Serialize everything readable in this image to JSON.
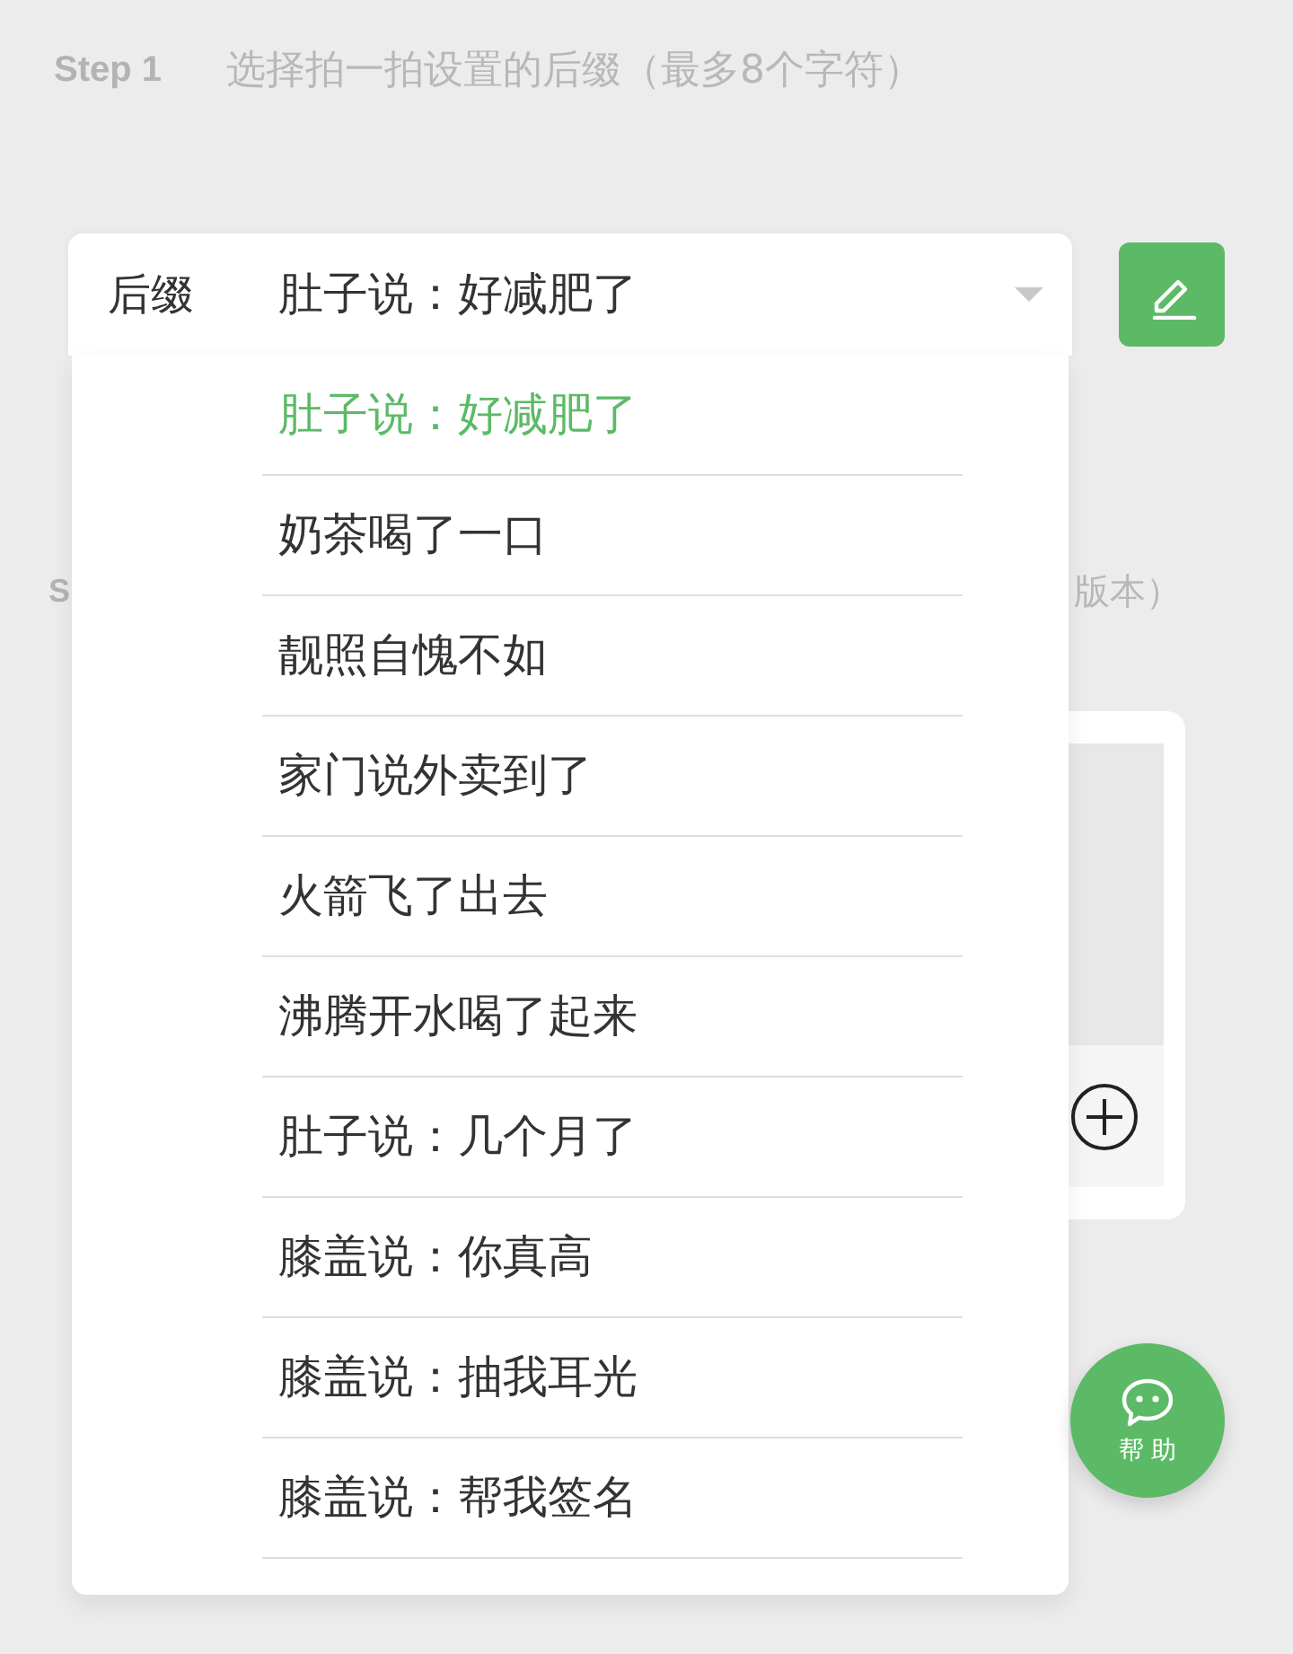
{
  "step1": {
    "label": "Step 1",
    "text": "选择拍一拍设置的后缀（最多8个字符）"
  },
  "suffix_select": {
    "label": "后缀",
    "value": "肚子说：好减肥了",
    "expanded": true
  },
  "step2": {
    "label": "S",
    "text": "版本）"
  },
  "dropdown_options": [
    {
      "text": "肚子说：好减肥了",
      "selected": true
    },
    {
      "text": "奶茶喝了一口",
      "selected": false
    },
    {
      "text": "靓照自愧不如",
      "selected": false
    },
    {
      "text": "家门说外卖到了",
      "selected": false
    },
    {
      "text": "火箭飞了出去",
      "selected": false
    },
    {
      "text": "沸腾开水喝了起来",
      "selected": false
    },
    {
      "text": "肚子说：几个月了",
      "selected": false
    },
    {
      "text": "膝盖说：你真高",
      "selected": false
    },
    {
      "text": "膝盖说：抽我耳光",
      "selected": false
    },
    {
      "text": "膝盖说：帮我签名",
      "selected": false
    }
  ],
  "help_button": {
    "label": "帮助"
  }
}
